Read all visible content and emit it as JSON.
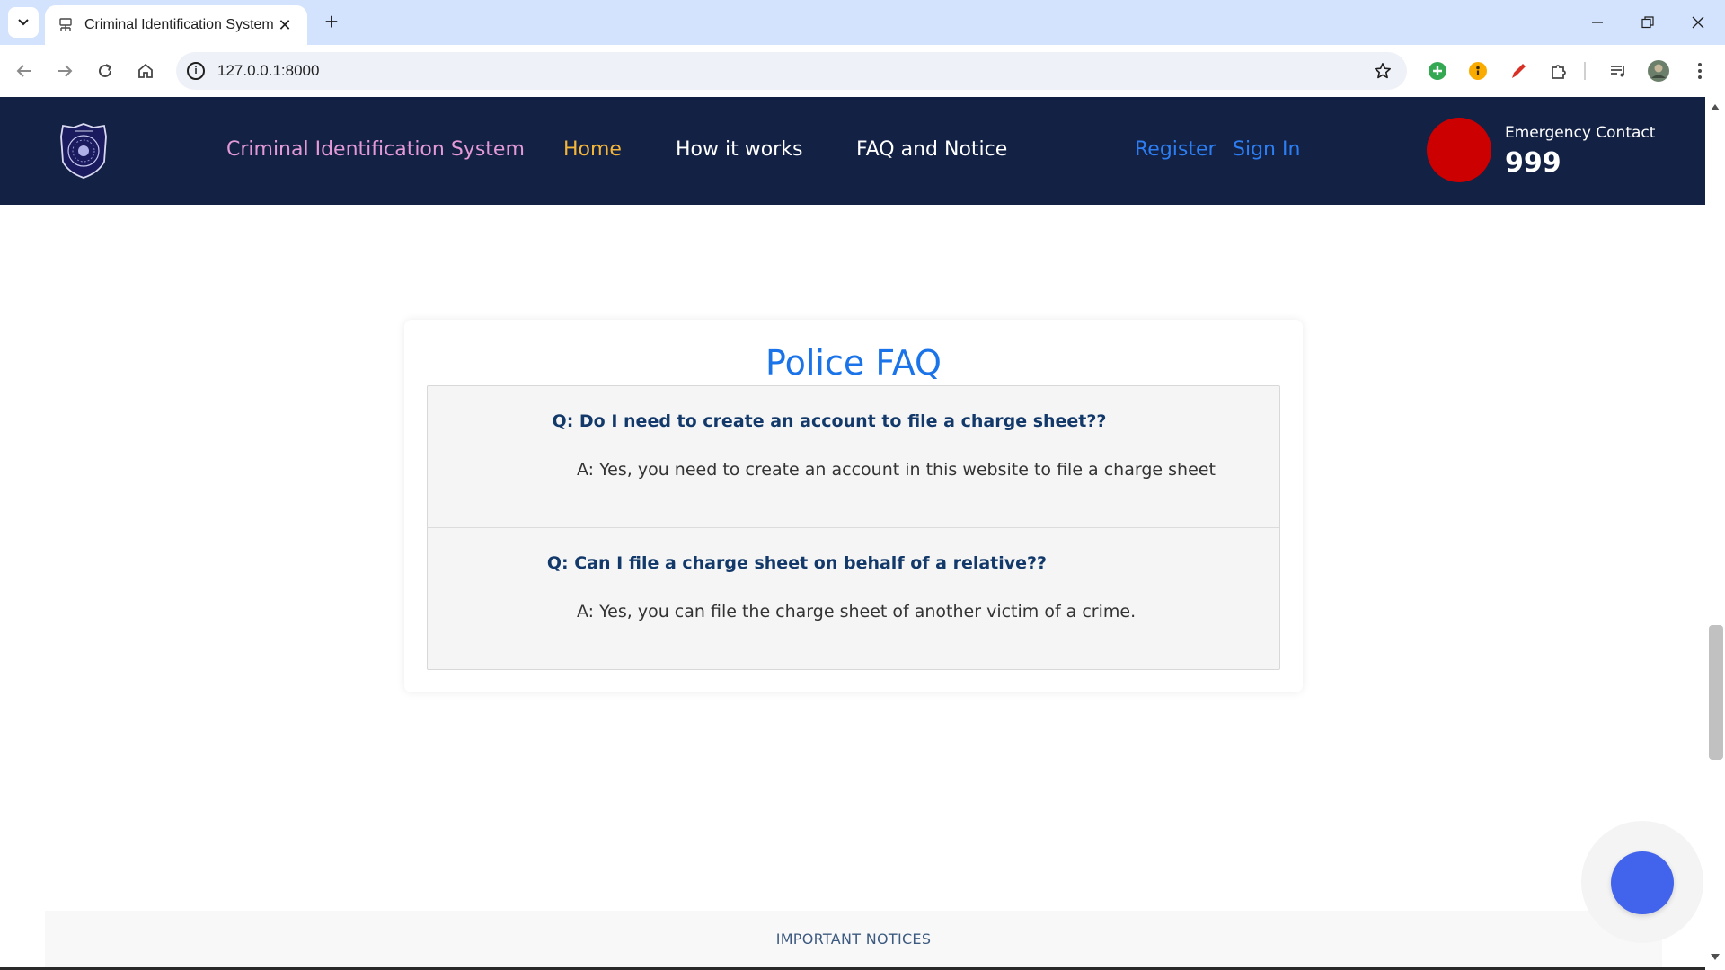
{
  "browser": {
    "tab_title": "Criminal Identification System",
    "tab_close": "✕",
    "new_tab": "+",
    "url": "127.0.0.1:8000"
  },
  "site": {
    "brand": "Criminal Identification System",
    "nav": [
      {
        "label": "Home",
        "active": true
      },
      {
        "label": "How it works"
      },
      {
        "label": "FAQ and Notice"
      }
    ],
    "auth": {
      "register": "Register",
      "signin": "Sign In"
    },
    "emergency": {
      "label": "Emergency Contact",
      "number": "999"
    }
  },
  "faq": {
    "title": "Police FAQ",
    "items": [
      {
        "q": "Q: Do I need to create an account to file a charge sheet??",
        "a": "A: Yes, you need to create an account in this website to file a charge sheet"
      },
      {
        "q": "Q: Can I file a charge sheet on behalf of a relative??",
        "a": "A: Yes, you can file the charge sheet of another victim of a crime."
      }
    ]
  },
  "notices": {
    "title": "IMPORTANT NOTICES"
  },
  "colors": {
    "header_bg": "#132145",
    "brand": "#e39ad6",
    "nav_active": "#f3b63b",
    "auth_link": "#2c7ef2",
    "emergency": "#cc0000",
    "faq_title": "#1a73e8",
    "faq_question": "#12396a",
    "fab": "#4263eb"
  },
  "icons": {
    "tab_menu": "chevron-down-icon",
    "back": "back-arrow-icon",
    "forward": "forward-arrow-icon",
    "reload": "reload-icon",
    "home": "home-icon",
    "site_info": "info-icon",
    "bookmark": "star-icon",
    "extensions": "puzzle-icon",
    "menu": "kebab-menu-icon"
  }
}
